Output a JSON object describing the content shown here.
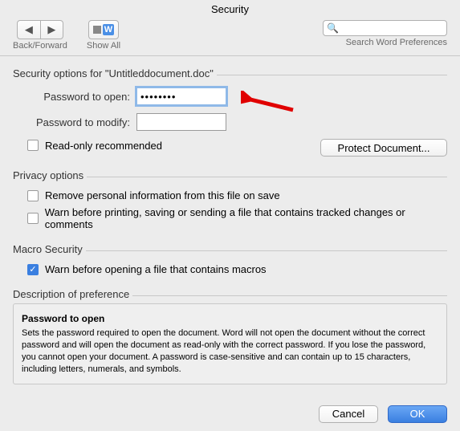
{
  "window": {
    "title": "Security"
  },
  "toolbar": {
    "back_forward_label": "Back/Forward",
    "show_all_label": "Show All",
    "search_placeholder": "",
    "search_label": "Search Word Preferences"
  },
  "security_options": {
    "legend": "Security options for \"Untitleddocument.doc\"",
    "password_open_label": "Password to open:",
    "password_open_value": "••••••••",
    "password_modify_label": "Password to modify:",
    "password_modify_value": "",
    "read_only_label": "Read-only recommended",
    "protect_button": "Protect Document..."
  },
  "privacy": {
    "legend": "Privacy options",
    "remove_personal_label": "Remove personal information from this file on save",
    "warn_printing_label": "Warn before printing, saving or sending a file that contains tracked changes or comments"
  },
  "macro": {
    "legend": "Macro Security",
    "warn_macros_label": "Warn before opening a file that contains macros"
  },
  "description": {
    "legend": "Description of preference",
    "title": "Password to open",
    "body": "Sets the password required to open the document. Word will not open the document without the correct password and will open the document as read-only with the correct password. If you lose the password, you cannot open your document. A password is case-sensitive and can contain up to 15 characters, including letters, numerals, and symbols."
  },
  "footer": {
    "cancel": "Cancel",
    "ok": "OK"
  }
}
